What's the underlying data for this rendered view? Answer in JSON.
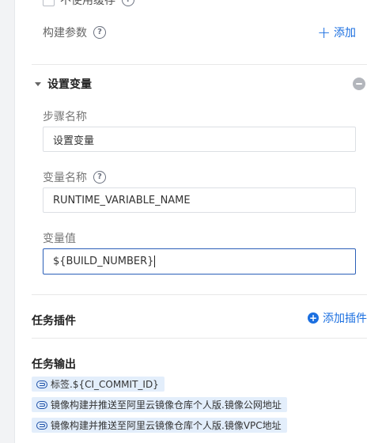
{
  "cache_option": {
    "label": "不使用缓存"
  },
  "build_params": {
    "label": "构建参数",
    "add_label": "添加"
  },
  "step": {
    "title": "设置变量",
    "step_name": {
      "label": "步骤名称",
      "value": "设置变量"
    },
    "variable_name": {
      "label": "变量名称",
      "value": "RUNTIME_VARIABLE_NAME"
    },
    "variable_value": {
      "label": "变量值",
      "value": "${BUILD_NUMBER}"
    }
  },
  "task_plugins": {
    "title": "任务插件",
    "add_label": "添加插件"
  },
  "task_outputs": {
    "title": "任务输出",
    "items": [
      "标签.${CI_COMMIT_ID}",
      "镜像构建并推送至阿里云镜像仓库个人版.镜像公网地址",
      "镜像构建并推送至阿里云镜像仓库个人版.镜像VPC地址"
    ]
  },
  "icons": {
    "help": "question-circle-icon",
    "remove": "minus-circle-icon",
    "add": "plus-icon",
    "add_circle": "plus-circle-icon",
    "link": "link-icon",
    "caret": "caret-down-icon"
  },
  "colors": {
    "accent": "#1b6fe0",
    "focus_border": "#2b5fb8",
    "tag_bg": "#e3eefb"
  }
}
